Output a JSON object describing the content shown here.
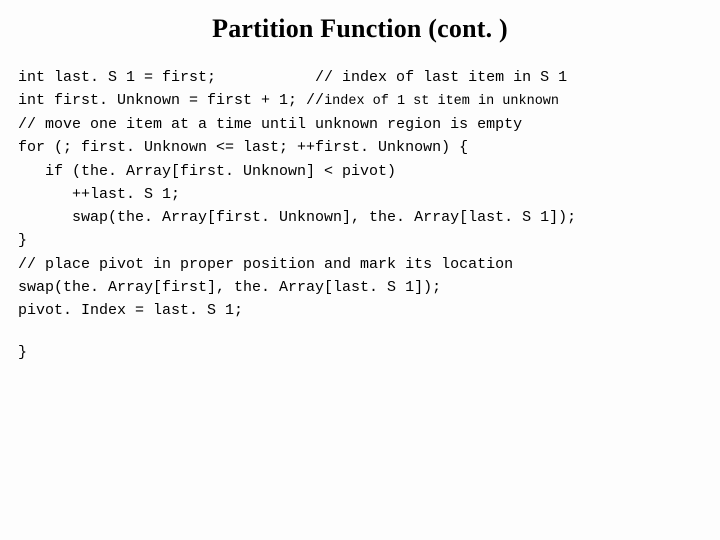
{
  "title": "Partition Function (cont. )",
  "code": {
    "l1a": "int last. S 1 = first;           // index of last item in S 1",
    "l1b_left": "int first. Unknown = first + 1; //",
    "l1b_right": "index of 1 st item in unknown",
    "l2a": "// move one item at a time until unknown region is empty",
    "l2b": "for (; first. Unknown <= last; ++first. Unknown) {",
    "l2c": "   if (the. Array[first. Unknown] < pivot)",
    "l2d": "      ++last. S 1;",
    "l2e": "      swap(the. Array[first. Unknown], the. Array[last. S 1]);",
    "l2f": "}",
    "l3a": "// place pivot in proper position and mark its location",
    "l3b": "swap(the. Array[first], the. Array[last. S 1]);",
    "l3c": "pivot. Index = last. S 1;",
    "close": "}"
  }
}
